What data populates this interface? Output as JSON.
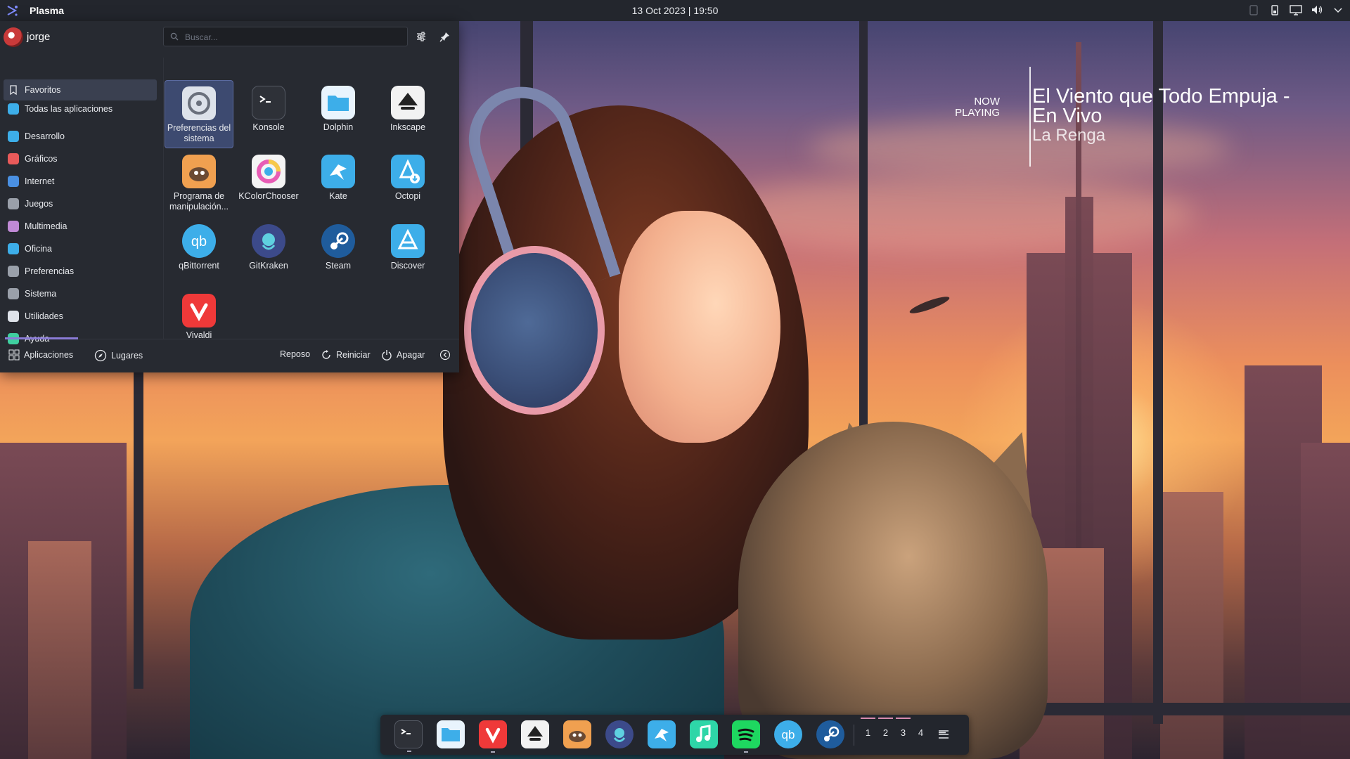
{
  "top_panel": {
    "launcher_title": "Plasma",
    "datetime": "13 Oct 2023 | 19:50",
    "tray_icons": [
      "clipboard-icon",
      "battery-icon",
      "display-icon",
      "volume-icon",
      "chevron-down-icon"
    ]
  },
  "menu": {
    "user": "jorge",
    "search_placeholder": "Buscar...",
    "categories": [
      {
        "label": "Favoritos",
        "icon": "bookmark-icon",
        "color": "#3a4050"
      },
      {
        "label": "Todas las aplicaciones",
        "icon": "grid-icon",
        "color": "#3daee9"
      },
      {
        "label": "Desarrollo",
        "icon": "development-icon",
        "color": "#3daee9"
      },
      {
        "label": "Gráficos",
        "icon": "graphics-icon",
        "color": "#e95a5a"
      },
      {
        "label": "Internet",
        "icon": "internet-icon",
        "color": "#4a90e2"
      },
      {
        "label": "Juegos",
        "icon": "games-icon",
        "color": "#9aa0aa"
      },
      {
        "label": "Multimedia",
        "icon": "multimedia-icon",
        "color": "#c08ad6"
      },
      {
        "label": "Oficina",
        "icon": "office-icon",
        "color": "#3daee9"
      },
      {
        "label": "Preferencias",
        "icon": "preferences-icon",
        "color": "#9aa0aa"
      },
      {
        "label": "Sistema",
        "icon": "system-icon",
        "color": "#9aa0aa"
      },
      {
        "label": "Utilidades",
        "icon": "utilities-icon",
        "color": "#dfe3ea"
      },
      {
        "label": "Ayuda",
        "icon": "help-icon",
        "color": "#3fd0a0"
      }
    ],
    "apps": [
      {
        "label": "Preferencias del sistema",
        "icon": "system-settings-icon",
        "color": "#dde2ea"
      },
      {
        "label": "Konsole",
        "icon": "terminal-icon",
        "color": "#2e3138"
      },
      {
        "label": "Dolphin",
        "icon": "folder-icon",
        "color": "#e9f4fd"
      },
      {
        "label": "Inkscape",
        "icon": "inkscape-icon",
        "color": "#f2f2f2"
      },
      {
        "label": "Programa de manipulación...",
        "icon": "gimp-icon",
        "color": "#f0a050"
      },
      {
        "label": "KColorChooser",
        "icon": "color-chooser-icon",
        "color": "#f4f4f4"
      },
      {
        "label": "Kate",
        "icon": "kate-icon",
        "color": "#3daee9"
      },
      {
        "label": "Octopi",
        "icon": "octopi-icon",
        "color": "#3daee9"
      },
      {
        "label": "qBittorrent",
        "icon": "qbittorrent-icon",
        "color": "#3daee9"
      },
      {
        "label": "GitKraken",
        "icon": "gitkraken-icon",
        "color": "#3c4a8a"
      },
      {
        "label": "Steam",
        "icon": "steam-icon",
        "color": "#1f5c9c"
      },
      {
        "label": "Discover",
        "icon": "discover-icon",
        "color": "#3daee9"
      },
      {
        "label": "Vivaldi",
        "icon": "vivaldi-icon",
        "color": "#ef3939"
      }
    ],
    "footer": {
      "applications": "Aplicaciones",
      "places": "Lugares",
      "sleep": "Reposo",
      "restart": "Reiniciar",
      "shutdown": "Apagar"
    }
  },
  "now_playing": {
    "label_1": "NOW",
    "label_2": "PLAYING",
    "title": "El Viento que Todo Empuja - En Vivo",
    "artist": "La Renga"
  },
  "dock": {
    "apps": [
      {
        "name": "terminal-icon",
        "color": "#2e3138"
      },
      {
        "name": "folder-icon",
        "color": "#e9f4fd"
      },
      {
        "name": "vivaldi-icon",
        "color": "#ef3939"
      },
      {
        "name": "inkscape-icon",
        "color": "#f2f2f2"
      },
      {
        "name": "gimp-icon",
        "color": "#f0a050"
      },
      {
        "name": "gitkraken-icon",
        "color": "#3c4a8a"
      },
      {
        "name": "kate-icon",
        "color": "#3daee9"
      },
      {
        "name": "music-icon",
        "color": "#2ed6a8"
      },
      {
        "name": "spotify-icon",
        "color": "#1ed760"
      },
      {
        "name": "qbittorrent-icon",
        "color": "#3daee9"
      },
      {
        "name": "steam-icon",
        "color": "#1f5c9c"
      }
    ],
    "desktops": [
      "1",
      "2",
      "3",
      "4"
    ]
  }
}
